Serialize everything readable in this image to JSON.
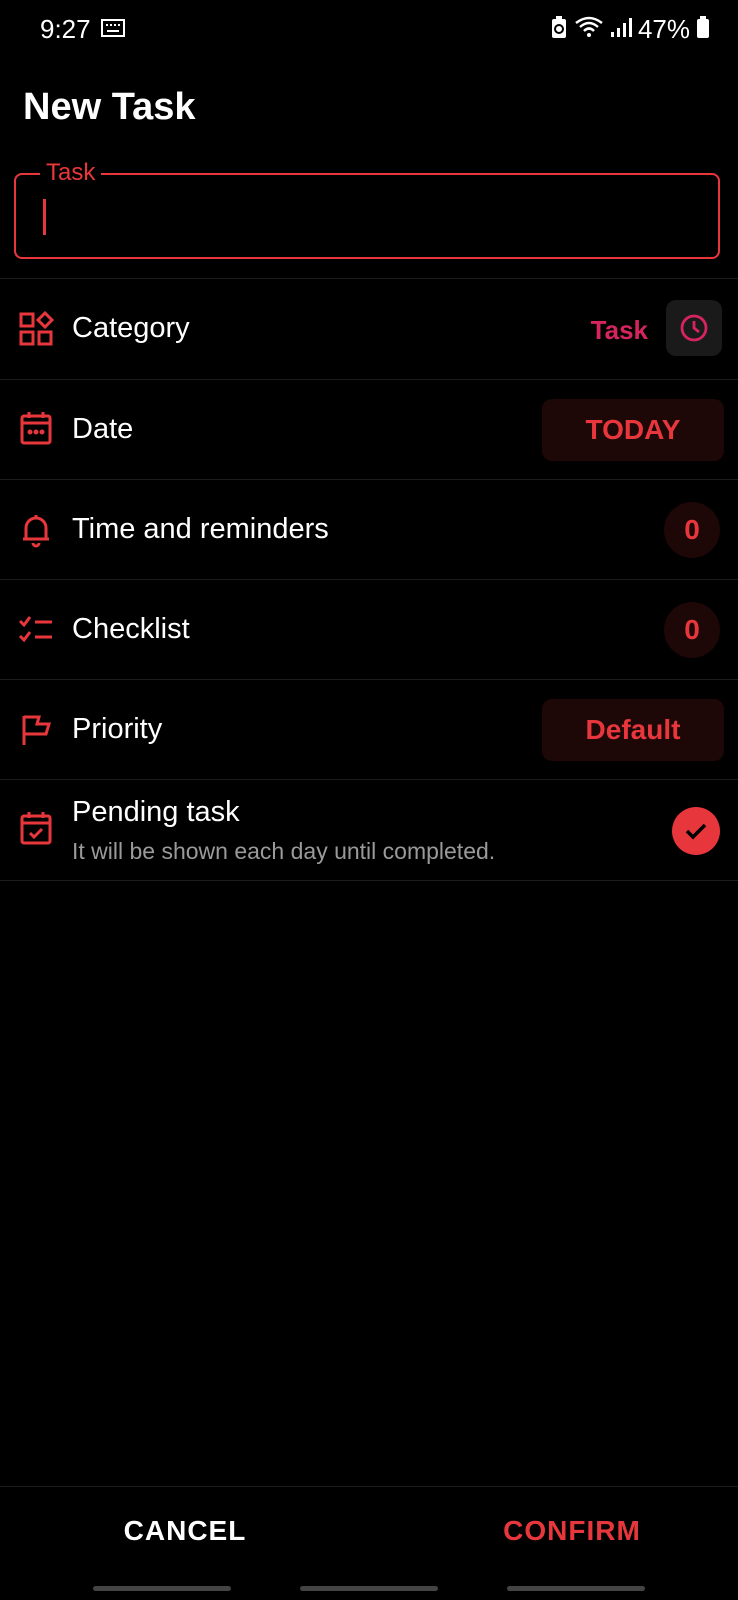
{
  "status_bar": {
    "time": "9:27",
    "battery": "47%"
  },
  "header": {
    "title": "New Task"
  },
  "task_field": {
    "label": "Task",
    "value": "",
    "placeholder": ""
  },
  "rows": {
    "category": {
      "label": "Category",
      "value": "Task"
    },
    "date": {
      "label": "Date",
      "value": "TODAY"
    },
    "time_reminders": {
      "label": "Time and reminders",
      "count": "0"
    },
    "checklist": {
      "label": "Checklist",
      "count": "0"
    },
    "priority": {
      "label": "Priority",
      "value": "Default"
    },
    "pending": {
      "title": "Pending task",
      "subtitle": "It will be shown each day until completed.",
      "checked": true
    }
  },
  "footer": {
    "cancel_label": "CANCEL",
    "confirm_label": "CONFIRM"
  },
  "colors": {
    "accent": "#e8373c",
    "category_accent": "#d6245e",
    "background": "#000000"
  },
  "icons": {
    "category": "category-grid-icon",
    "date": "calendar-icon",
    "time": "bell-icon",
    "checklist": "checklist-icon",
    "priority": "flag-icon",
    "pending": "calendar-check-icon",
    "category_action": "clock-icon"
  }
}
